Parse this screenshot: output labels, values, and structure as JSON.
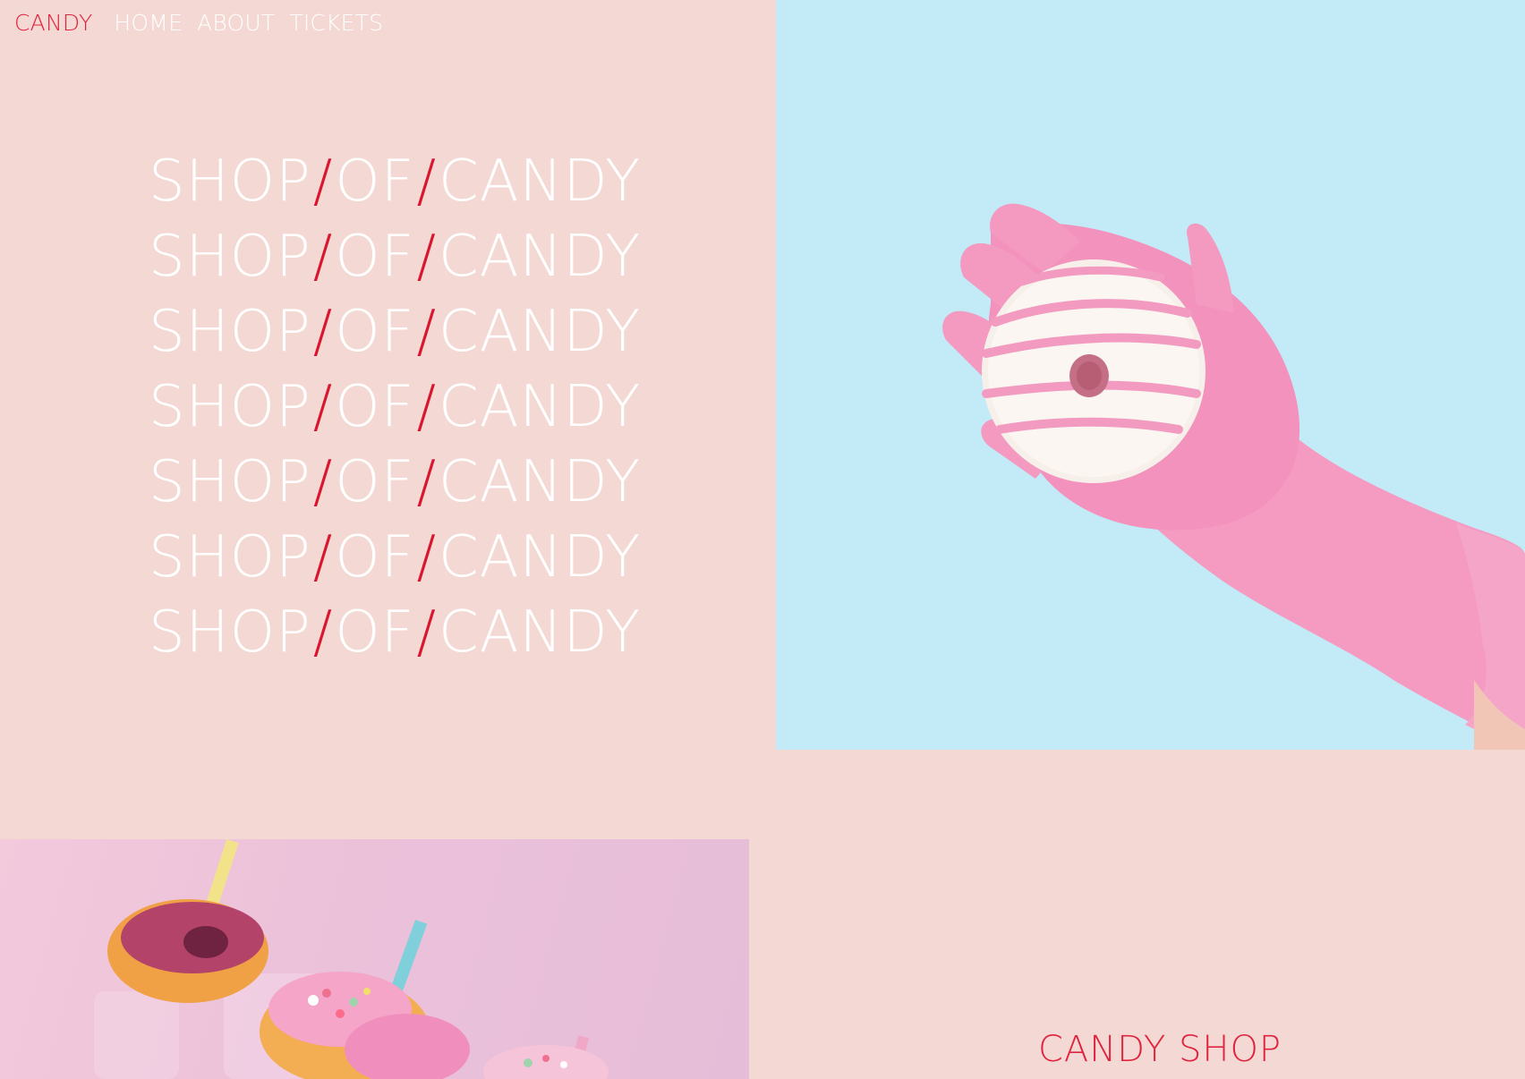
{
  "nav": {
    "brand": "CANDY",
    "links": [
      {
        "label": "HOME"
      },
      {
        "label": "ABOUT"
      },
      {
        "label": "TICKETS"
      }
    ]
  },
  "hero": {
    "lines": [
      {
        "a": "SHOP",
        "sep1": "/",
        "b": "OF",
        "sep2": "/",
        "c": "CANDY"
      },
      {
        "a": "SHOP",
        "sep1": "/",
        "b": "OF",
        "sep2": "/",
        "c": "CANDY"
      },
      {
        "a": "SHOP",
        "sep1": "/",
        "b": "OF",
        "sep2": "/",
        "c": "CANDY"
      },
      {
        "a": "SHOP",
        "sep1": "/",
        "b": "OF",
        "sep2": "/",
        "c": "CANDY"
      },
      {
        "a": "SHOP",
        "sep1": "/",
        "b": "OF",
        "sep2": "/",
        "c": "CANDY"
      },
      {
        "a": "SHOP",
        "sep1": "/",
        "b": "OF",
        "sep2": "/",
        "c": "CANDY"
      },
      {
        "a": "SHOP",
        "sep1": "/",
        "b": "OF",
        "sep2": "/",
        "c": "CANDY"
      }
    ]
  },
  "section": {
    "title": "CANDY SHOP"
  },
  "colors": {
    "background": "#f4d8d3",
    "accent": "#e0233f",
    "slash": "#d8162f",
    "sky": "#c2ebf7",
    "glove": "#f59bc2"
  }
}
